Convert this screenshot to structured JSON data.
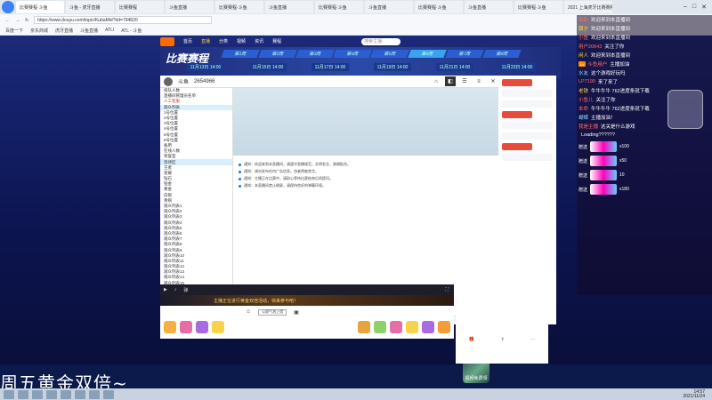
{
  "browser": {
    "tabs": [
      "比赛赛程·斗鱼",
      "斗鱼 - 虎牙直播",
      "比赛赛程",
      "斗鱼直播",
      "比赛赛程·斗鱼",
      "斗鱼直播",
      "比赛赛程·斗鱼",
      "斗鱼直播",
      "比赛赛程·斗鱼",
      "斗鱼直播",
      "比赛赛程·斗鱼",
      "斗鱼直播",
      "2021 上海虎牙比赛赛程"
    ],
    "url": "https://www.douyu.com/topic/KubaMid?rid=794820",
    "bookmarks": [
      "百度一下",
      "京东商城",
      "虎牙直播",
      "斗鱼直播",
      "ATLI",
      "ATL - 斗鱼"
    ]
  },
  "site": {
    "nav": [
      "首页",
      "直播",
      "分类",
      "视频",
      "资讯",
      "赛程"
    ],
    "search_placeholder": "搜索主播",
    "banner_title": "比赛赛程",
    "stages": [
      "第1周",
      "第2周",
      "第3周",
      "第4周",
      "第5周",
      "第6周",
      "第7周",
      "第8周"
    ],
    "dates": [
      "11月13日 14:00",
      "11月15日 14:00",
      "11月17日 14:00",
      "11月19日 14:00",
      "11月21日 14:00",
      "11月23日 14:00"
    ]
  },
  "player": {
    "streamer": "斗鱼",
    "room_no": "2654966",
    "tree_items": [
      "排队人数",
      "直播间管理员名单",
      "人工客服",
      "观众列表",
      "1号位置",
      "2号位置",
      "3号位置",
      "4号位置",
      "5号位置",
      "6号位置",
      "备用",
      "在线人数",
      "荣誉室",
      "等待区",
      "王者",
      "星耀",
      "钻石",
      "铂金",
      "黄金",
      "白银",
      "青铜",
      "观众列表1",
      "观众列表2",
      "观众列表3",
      "观众列表4",
      "观众列表5",
      "观众列表6",
      "观众列表7",
      "观众列表8",
      "观众列表9",
      "观众列表10",
      "观众列表11",
      "观众列表12",
      "观众列表13",
      "观众列表14",
      "观众列表15",
      "观众列表16",
      "观众列表17",
      "观众列表18"
    ],
    "log_lines": [
      "通知：欢迎来到本直播间，请遵守直播规范，文明发言，谢谢配合。",
      "通知：请勿发布任何广告信息，违者将被禁言。",
      "通知：主播正在比赛中，请耐心等待比赛结束后再提问。",
      "通知：本直播间禁止刷屏，请保持良好的弹幕环境。"
    ],
    "input_tag": "公屏气泡上墙",
    "promo_label": "视频免费领",
    "footer": [
      "主播",
      "消息",
      "设置"
    ]
  },
  "marquee": "主播正在进行黄金双倍活动，快来参与吧！",
  "chat": [
    {
      "name": "萌新",
      "text": "欢迎来到本直播间",
      "color": "r"
    },
    {
      "name": "朝夕",
      "text": "欢迎来到本直播间",
      "color": "y"
    },
    {
      "name": "小鱼",
      "text": "欢迎来到本直播间",
      "color": "r"
    },
    {
      "name": "用户20643",
      "text": "关注了你",
      "color": "r"
    },
    {
      "name": "闲人",
      "text": "欢迎来到本直播间",
      "color": "y"
    },
    {
      "name": "斗鱼用户",
      "text": "主播加油",
      "color": "r"
    },
    {
      "name": "水友",
      "text": "这个游戏好玩吗",
      "color": "b"
    },
    {
      "name": "LP7190",
      "text": "来了来了",
      "color": "r"
    },
    {
      "name": "老铁",
      "text": "牛牛牛牛 762进度条就下载",
      "color": "y"
    },
    {
      "name": "小鱼儿",
      "text": "关注了你",
      "color": "r"
    },
    {
      "name": "本命",
      "text": "牛牛牛牛 762进度条就下载",
      "color": "r"
    },
    {
      "name": "蝴蝶",
      "text": "主播加油！",
      "color": "b"
    },
    {
      "name": "我是主播",
      "text": "这关是什么游戏",
      "color": "r"
    },
    {
      "name": "",
      "text": "Loading??????",
      "color": "y"
    }
  ],
  "gifts": [
    {
      "name": "赠送",
      "count": "x100"
    },
    {
      "name": "赠送",
      "count": "x50"
    },
    {
      "name": "赠送",
      "count": "10"
    },
    {
      "name": "赠送",
      "count": "x180"
    }
  ],
  "subtitle": "周五黄金双倍~",
  "clock": {
    "time": "14:57",
    "date": "2021/11/24"
  }
}
